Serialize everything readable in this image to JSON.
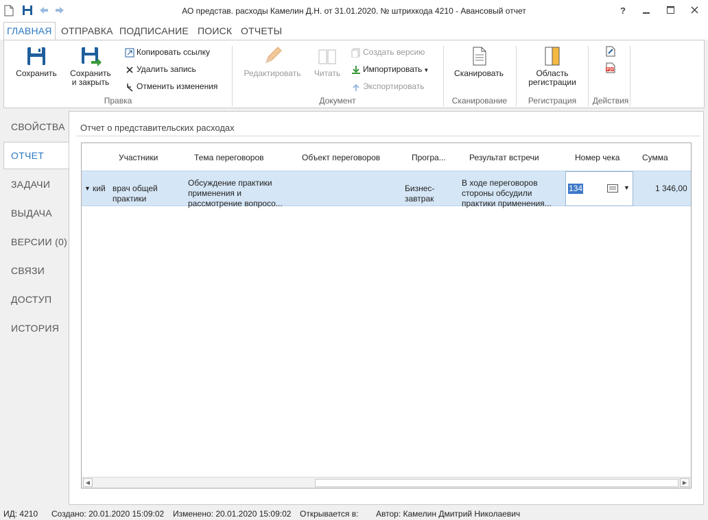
{
  "window": {
    "title": "АО представ. расходы Камелин Д.Н. от 31.01.2020. № штрихкода 4210 - Авансовый отчет",
    "help": "?"
  },
  "ribbon_tabs": [
    "ГЛАВНАЯ",
    "ОТПРАВКА",
    "ПОДПИСАНИЕ",
    "ПОИСК",
    "ОТЧЕТЫ"
  ],
  "ribbon": {
    "save": "Сохранить",
    "save_close_1": "Сохранить",
    "save_close_2": "и закрыть",
    "copy_link": "Копировать ссылку",
    "delete": "Удалить запись",
    "undo": "Отменить изменения",
    "group_edit": "Правка",
    "edit": "Редактировать",
    "read": "Читать",
    "create_version": "Создать версию",
    "import": "Импортировать",
    "export": "Экспортировать",
    "group_document": "Документ",
    "scan": "Сканировать",
    "group_scan": "Сканирование",
    "reg_area_1": "Область",
    "reg_area_2": "регистрации",
    "group_registration": "Регистрация",
    "group_actions": "Действия"
  },
  "nav": [
    "СВОЙСТВА",
    "ОТЧЕТ",
    "ЗАДАЧИ",
    "ВЫДАЧА",
    "ВЕРСИИ (0)",
    "СВЯЗИ",
    "ДОСТУП",
    "ИСТОРИЯ"
  ],
  "section_title": "Отчет о представительских расходах",
  "table": {
    "headers": [
      "Участники",
      "Тема переговоров",
      "Объект переговоров",
      "Програ...",
      "Результат встречи",
      "Номер чека",
      "Сумма"
    ],
    "row": {
      "clipped": "кий",
      "participants_1": "врач общей",
      "participants_2": "практики",
      "topic_1": "Обсуждение практики",
      "topic_2": "применения и",
      "topic_3": "рассмотрение  вопросо...",
      "program_1": "Бизнес-",
      "program_2": "завтрак",
      "result_1": "В ходе переговоров",
      "result_2": "стороны обсудили",
      "result_3": "практики применения...",
      "check": "134",
      "sum": "1 346,00"
    }
  },
  "status": {
    "id": "ИД: 4210",
    "created": "Создано: 20.01.2020 15:09:02",
    "modified": "Изменено: 20.01.2020 15:09:02",
    "opens_in": "Открывается в:",
    "author": "Автор: Камелин Дмитрий Николаевич"
  }
}
